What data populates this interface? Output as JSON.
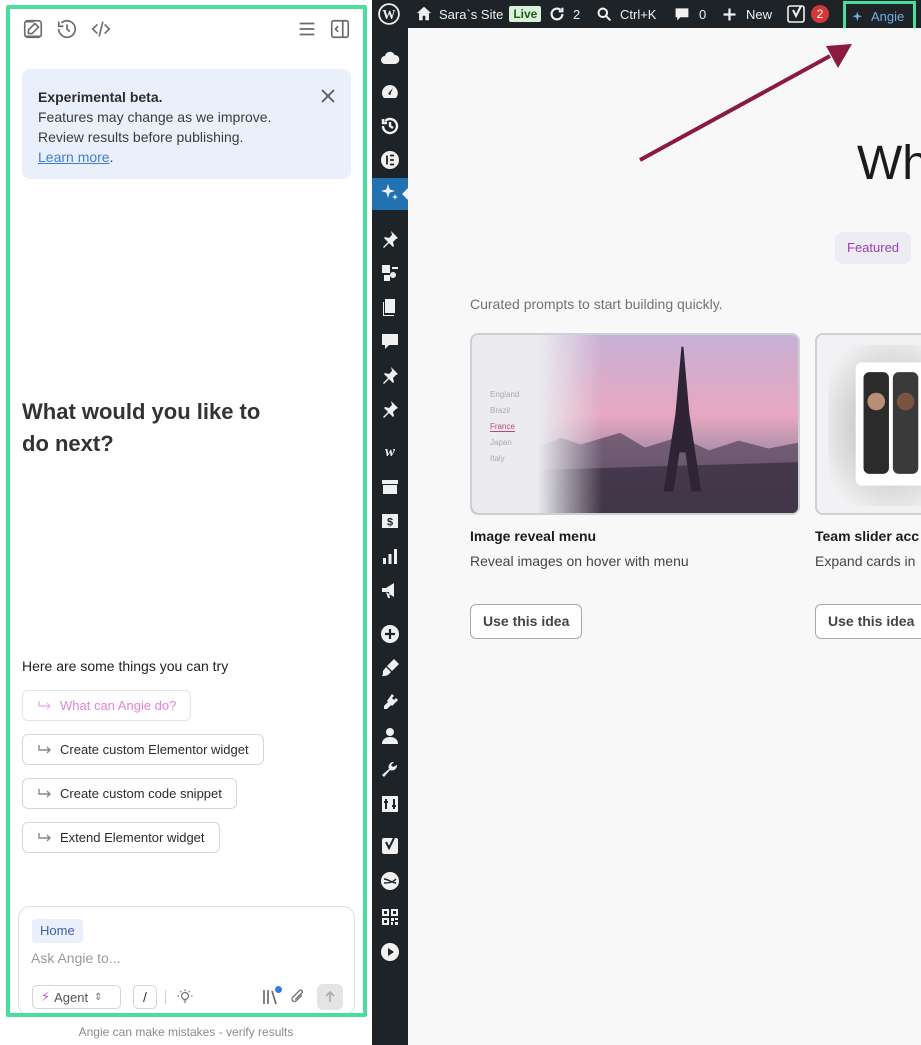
{
  "angie_panel": {
    "beta_notice": {
      "title": "Experimental beta.",
      "line1": "Features may change as we improve.",
      "line2": "Review results before publishing.",
      "learn_more": "Learn more",
      "period": "."
    },
    "heading": "What would you like to do next?",
    "suggestions_label": "Here are some things you can try",
    "suggestions": [
      {
        "label": "What can Angie do?"
      },
      {
        "label": "Create custom Elementor widget"
      },
      {
        "label": "Create custom code snippet"
      },
      {
        "label": "Extend Elementor widget"
      }
    ],
    "composer": {
      "context_chip": "Home",
      "placeholder": "Ask Angie to...",
      "mode": "Agent",
      "slash": "/"
    },
    "disclaimer": "Angie can make mistakes - verify results"
  },
  "admin_bar": {
    "site_name": "Sara`s Site",
    "live_badge": "Live",
    "updates_count": "2",
    "search_shortcut": "Ctrl+K",
    "comments_count": "0",
    "new_label": "New",
    "yoast_count": "2",
    "angie_label": "Angie"
  },
  "main": {
    "heading": "Wh",
    "featured_tab": "Featured",
    "curated_text": "Curated prompts to start building quickly.",
    "cards": [
      {
        "title": "Image reveal menu",
        "desc": "Reveal images on hover with menu",
        "button": "Use this idea",
        "menu_items": [
          "England",
          "Brazil",
          "France",
          "Japan",
          "Italy"
        ]
      },
      {
        "title": "Team slider acc",
        "desc": "Expand cards in",
        "button": "Use this idea"
      }
    ]
  },
  "colors": {
    "highlight": "#4ade9c",
    "admin_bar": "#1d2327",
    "active_menu": "#2271b1",
    "annotation_arrow": "#8b1a3f",
    "featured_accent": "#9d3fb5"
  }
}
